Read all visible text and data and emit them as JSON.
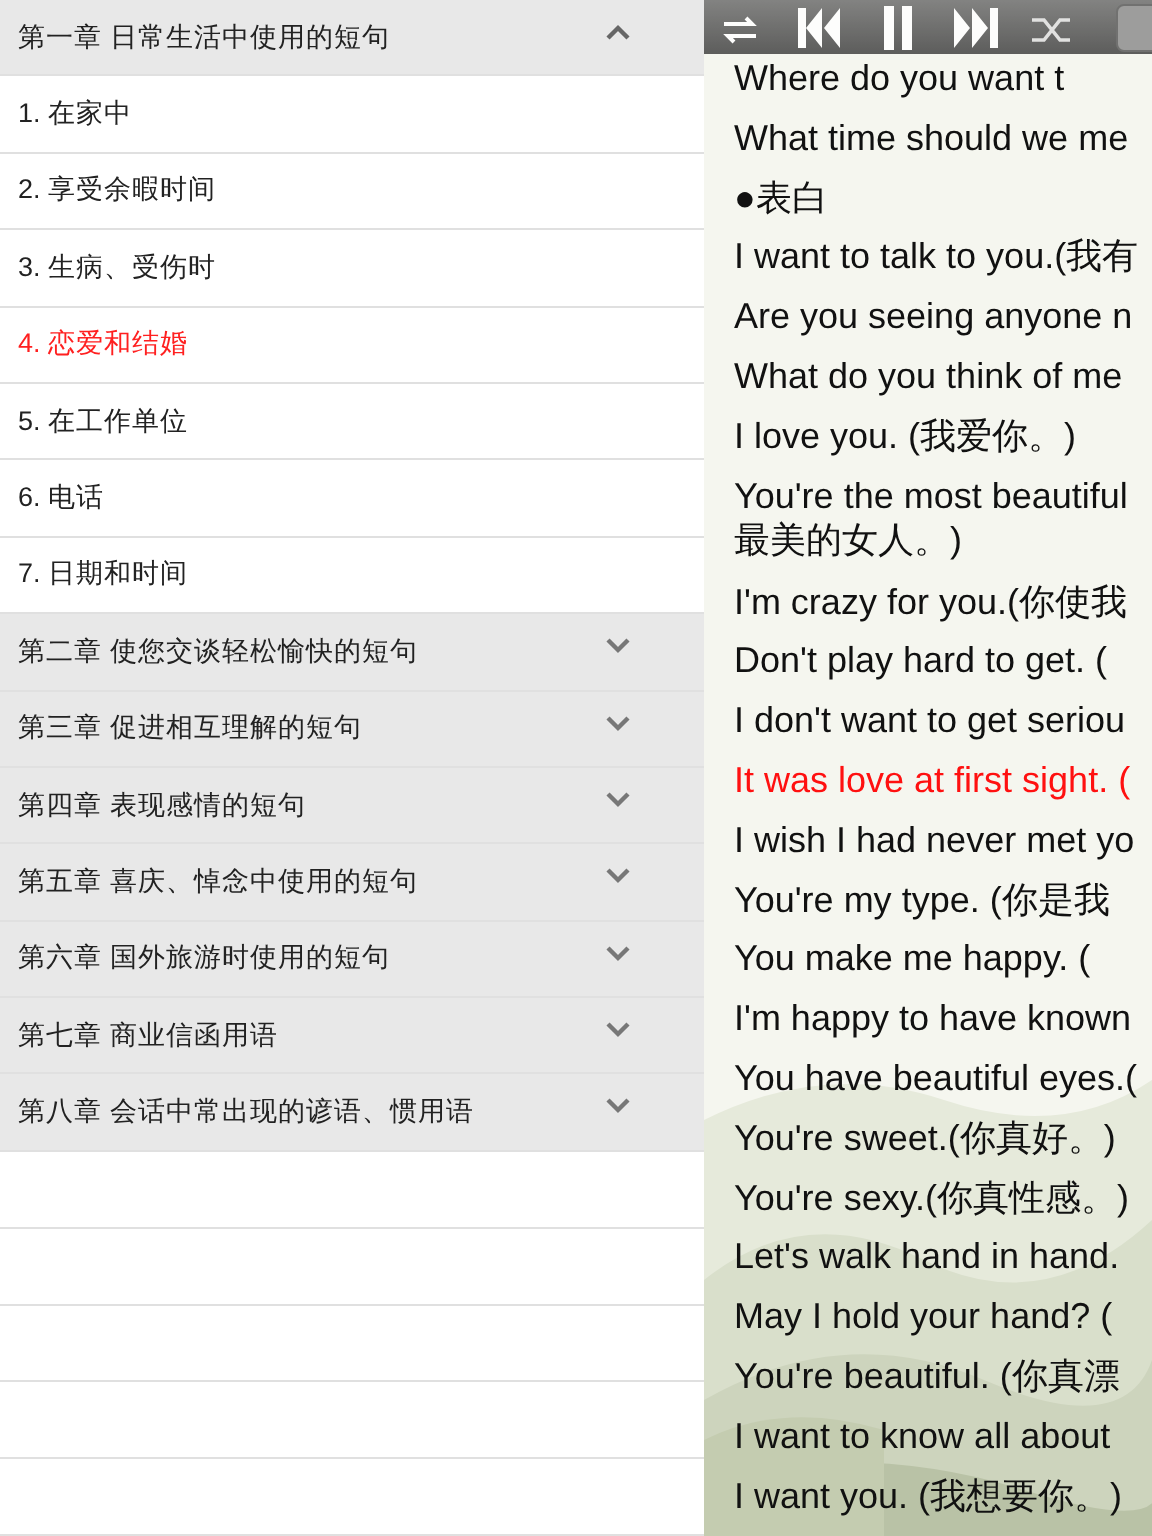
{
  "chapters": [
    {
      "title": "第一章 日常生活中使用的短句",
      "expanded": true,
      "items": [
        {
          "label": "1. 在家中",
          "selected": false
        },
        {
          "label": "2. 享受余暇时间",
          "selected": false
        },
        {
          "label": "3. 生病、受伤时",
          "selected": false
        },
        {
          "label": "4. 恋爱和结婚",
          "selected": true
        },
        {
          "label": "5. 在工作单位",
          "selected": false
        },
        {
          "label": "6. 电话",
          "selected": false
        },
        {
          "label": "7. 日期和时间",
          "selected": false
        }
      ]
    },
    {
      "title": "第二章 使您交谈轻松愉快的短句",
      "expanded": false
    },
    {
      "title": "第三章 促进相互理解的短句",
      "expanded": false
    },
    {
      "title": "第四章 表现感情的短句",
      "expanded": false
    },
    {
      "title": "第五章  喜庆、悼念中使用的短句",
      "expanded": false
    },
    {
      "title": "第六章  国外旅游时使用的短句",
      "expanded": false
    },
    {
      "title": "第七章  商业信函用语",
      "expanded": false
    },
    {
      "title": "第八章  会话中常出现的谚语、惯用语",
      "expanded": false
    }
  ],
  "player": {
    "playing": true
  },
  "lines": [
    {
      "text": "Where do you want t",
      "selected": false
    },
    {
      "text": "What time should we me",
      "selected": false
    },
    {
      "text": "●表白",
      "selected": false
    },
    {
      "text": "I want to talk to you.(我有",
      "selected": false
    },
    {
      "text": "Are you seeing anyone n",
      "selected": false
    },
    {
      "text": "What do you think of me",
      "selected": false
    },
    {
      "text": "I love you. (我爱你。)",
      "selected": false
    },
    {
      "text": "You're the most beautiful\n最美的女人。)",
      "selected": false
    },
    {
      "text": "I'm crazy for you.(你使我",
      "selected": false
    },
    {
      "text": "Don't play hard to get. (",
      "selected": false
    },
    {
      "text": "I don't want to get seriou",
      "selected": false
    },
    {
      "text": "It was love at first sight. (",
      "selected": true
    },
    {
      "text": "I wish I had never met yo",
      "selected": false
    },
    {
      "text": "You're my type. (你是我",
      "selected": false
    },
    {
      "text": "You make me happy. (",
      "selected": false
    },
    {
      "text": "I'm happy to have known",
      "selected": false
    },
    {
      "text": "You have beautiful eyes.(",
      "selected": false
    },
    {
      "text": "You're sweet.(你真好。)",
      "selected": false
    },
    {
      "text": "You're sexy.(你真性感。)",
      "selected": false
    },
    {
      "text": "Let's walk hand in hand.",
      "selected": false
    },
    {
      "text": "May I hold your hand? (",
      "selected": false
    },
    {
      "text": "You're beautiful. (你真漂",
      "selected": false
    },
    {
      "text": "I want to know all about",
      "selected": false
    },
    {
      "text": "I want you. (我想要你。)",
      "selected": false
    }
  ]
}
